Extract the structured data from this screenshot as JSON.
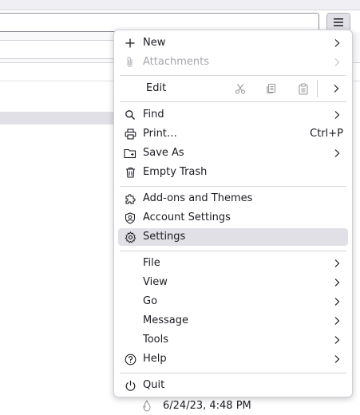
{
  "menu": {
    "items_top": [
      {
        "label": "New",
        "icon": "plus-icon",
        "submenu": true,
        "disabled": false
      },
      {
        "label": "Attachments",
        "icon": "paperclip-icon",
        "submenu": true,
        "disabled": true
      }
    ],
    "edit": {
      "label": "Edit",
      "icons": [
        "cut-icon",
        "copy-icon",
        "paste-icon"
      ]
    },
    "items_tools": [
      {
        "label": "Find",
        "icon": "search-icon",
        "submenu": true
      },
      {
        "label": "Print…",
        "icon": "printer-icon",
        "shortcut": "Ctrl+P"
      },
      {
        "label": "Save As",
        "icon": "folder-icon",
        "submenu": true
      },
      {
        "label": "Empty Trash",
        "icon": "trash-icon"
      }
    ],
    "items_settings": [
      {
        "label": "Add-ons and Themes",
        "icon": "puzzle-icon"
      },
      {
        "label": "Account Settings",
        "icon": "account-shield-icon"
      },
      {
        "label": "Settings",
        "icon": "gear-icon",
        "highlighted": true
      }
    ],
    "items_menus": [
      {
        "label": "File",
        "submenu": true
      },
      {
        "label": "View",
        "submenu": true
      },
      {
        "label": "Go",
        "submenu": true
      },
      {
        "label": "Message",
        "submenu": true
      },
      {
        "label": "Tools",
        "submenu": true
      },
      {
        "label": "Help",
        "icon": "help-icon",
        "submenu": true
      }
    ],
    "quit": {
      "label": "Quit",
      "icon": "power-icon"
    }
  },
  "message_list": {
    "visible_row_date": "6/24/23, 4:48 PM"
  },
  "colors": {
    "highlight": "#e0e0e6",
    "separator": "#d7d7db",
    "disabled_text": "#a6a6ad"
  }
}
